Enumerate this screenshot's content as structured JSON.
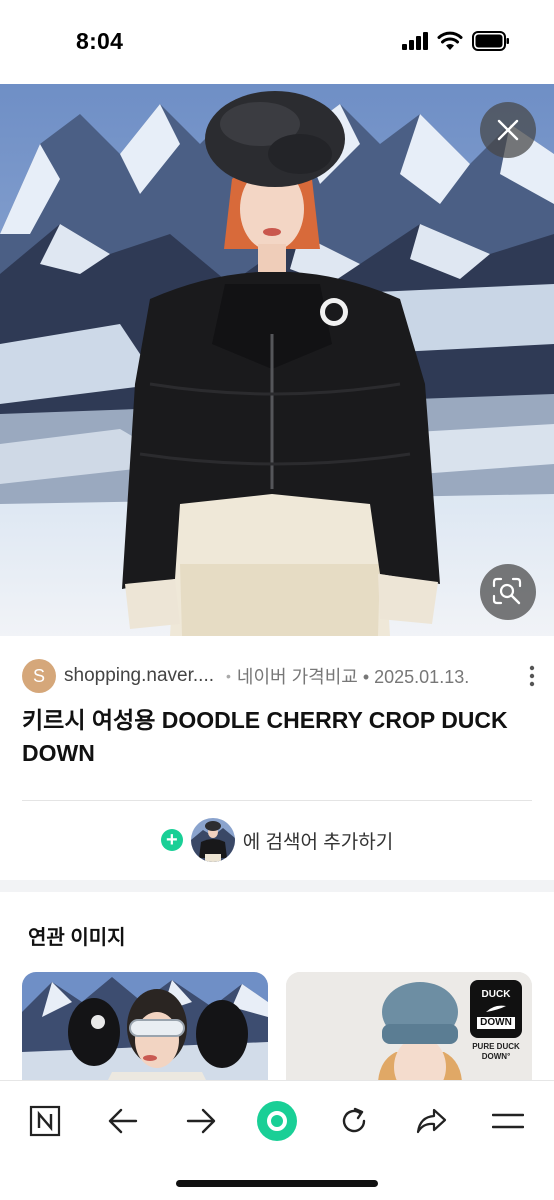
{
  "status_bar": {
    "time": "8:04"
  },
  "result": {
    "source_initial": "S",
    "source_domain": "shopping.naver....",
    "source_meta": "네이버 가격비교 • 2025.01.13.",
    "title": "키르시 여성용 DOODLE CHERRY CROP DUCK DOWN",
    "add_search_label": "에 검색어 추가하기"
  },
  "related": {
    "title": "연관 이미지",
    "card_right_badge": {
      "line1": "DUCK",
      "line2": "DOWN",
      "caption1": "PURE DUCK",
      "caption2": "DOWN°"
    }
  },
  "toolbar": {
    "items": [
      "naver-home",
      "back",
      "forward",
      "green-dot-home",
      "reload",
      "share",
      "menu"
    ]
  },
  "colors": {
    "accent_green": "#19cf96",
    "source_avatar": "#d5a77a"
  }
}
